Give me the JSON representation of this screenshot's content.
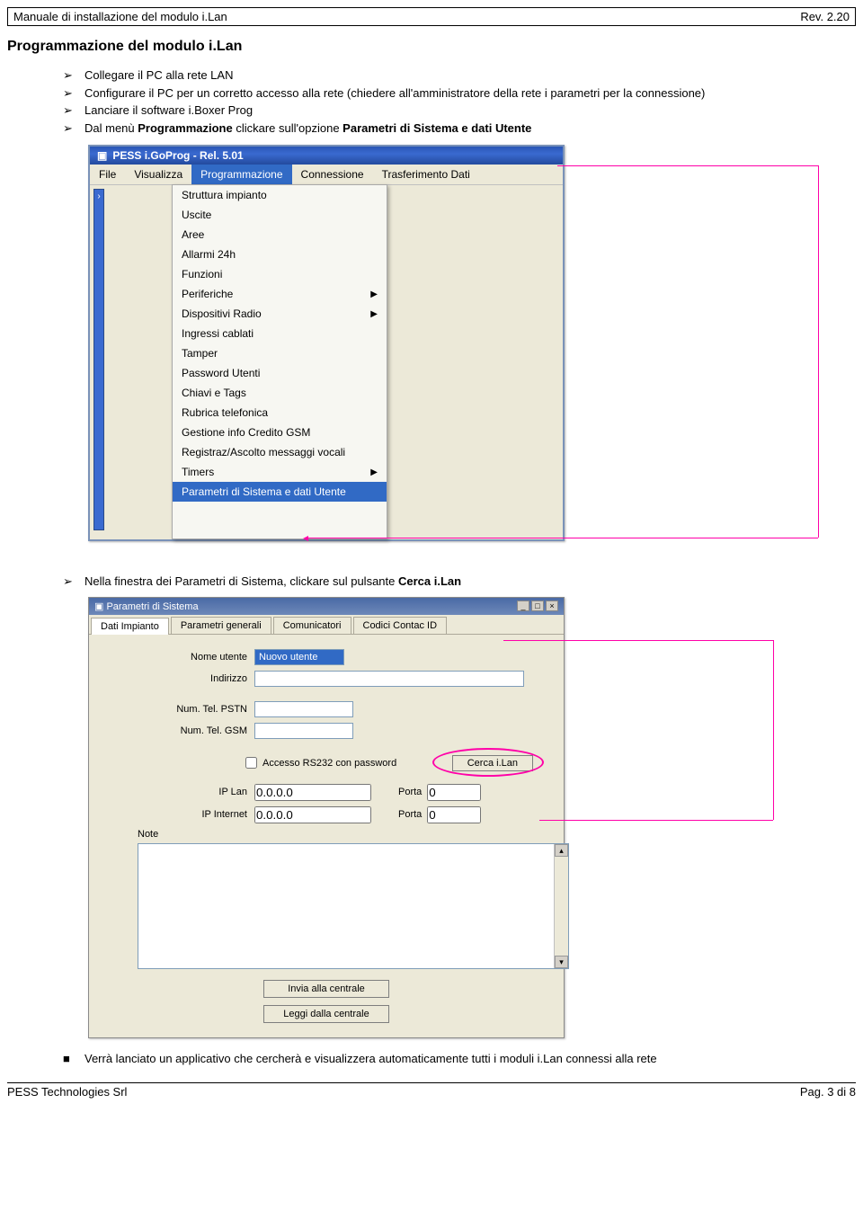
{
  "header": {
    "left": "Manuale di installazione del modulo i.Lan",
    "right": "Rev. 2.20"
  },
  "section_title": "Programmazione del modulo i.Lan",
  "bullets1": {
    "b0": "Collegare il PC alla rete LAN",
    "b1": "Configurare il PC per un corretto accesso alla rete (chiedere all'amministratore della rete i parametri per la connessione)",
    "b2": "Lanciare il software i.Boxer Prog",
    "b3_pre": "Dal menù ",
    "b3_bold1": "Programmazione",
    "b3_mid": " clickare sull'opzione ",
    "b3_bold2": "Parametri di Sistema e dati Utente"
  },
  "win1": {
    "title": "PESS  i.GoProg  -  Rel. 5.01",
    "menu": [
      "File",
      "Visualizza",
      "Programmazione",
      "Connessione",
      "Trasferimento Dati"
    ],
    "items": [
      {
        "label": "Struttura impianto",
        "sub": false
      },
      {
        "label": "Uscite",
        "sub": false
      },
      {
        "label": "Aree",
        "sub": false
      },
      {
        "label": "Allarmi 24h",
        "sub": false
      },
      {
        "label": "Funzioni",
        "sub": false
      },
      {
        "label": "Periferiche",
        "sub": true
      },
      {
        "label": "Dispositivi Radio",
        "sub": true
      },
      {
        "label": "Ingressi cablati",
        "sub": false
      },
      {
        "label": "Tamper",
        "sub": false
      },
      {
        "label": "Password Utenti",
        "sub": false
      },
      {
        "label": "Chiavi e Tags",
        "sub": false
      },
      {
        "label": "Rubrica telefonica",
        "sub": false
      },
      {
        "label": "Gestione info Credito GSM",
        "sub": false
      },
      {
        "label": "Registraz/Ascolto messaggi vocali",
        "sub": false
      },
      {
        "label": "Timers",
        "sub": true
      },
      {
        "label": "Parametri di Sistema e dati Utente",
        "sub": false,
        "hl": true
      }
    ]
  },
  "bullets2": {
    "b0_pre": "Nella finestra dei Parametri di Sistema, clickare sul pulsante ",
    "b0_bold": "Cerca i.Lan"
  },
  "win2": {
    "title": "Parametri di Sistema",
    "tabs": [
      "Dati Impianto",
      "Parametri generali",
      "Comunicatori",
      "Codici Contac ID"
    ],
    "labels": {
      "nome": "Nome utente",
      "indirizzo": "Indirizzo",
      "pstn": "Num. Tel. PSTN",
      "gsm": "Num. Tel. GSM",
      "chk": "Accesso RS232 con password",
      "cerca": "Cerca  i.Lan",
      "iplan": "IP Lan",
      "ipint": "IP Internet",
      "porta": "Porta",
      "note": "Note",
      "btn1": "Invia alla centrale",
      "btn2": "Leggi dalla centrale"
    },
    "values": {
      "nome": "Nuovo utente",
      "iplan": "0.0.0.0",
      "ipint": "0.0.0.0",
      "porta1": "0",
      "porta2": "0"
    }
  },
  "bullets3": {
    "b0": "Verrà lanciato un applicativo che cercherà e visualizzera automaticamente tutti i moduli i.Lan connessi alla rete"
  },
  "footer": {
    "left": "PESS Technologies Srl",
    "right": "Pag. 3 di 8"
  }
}
